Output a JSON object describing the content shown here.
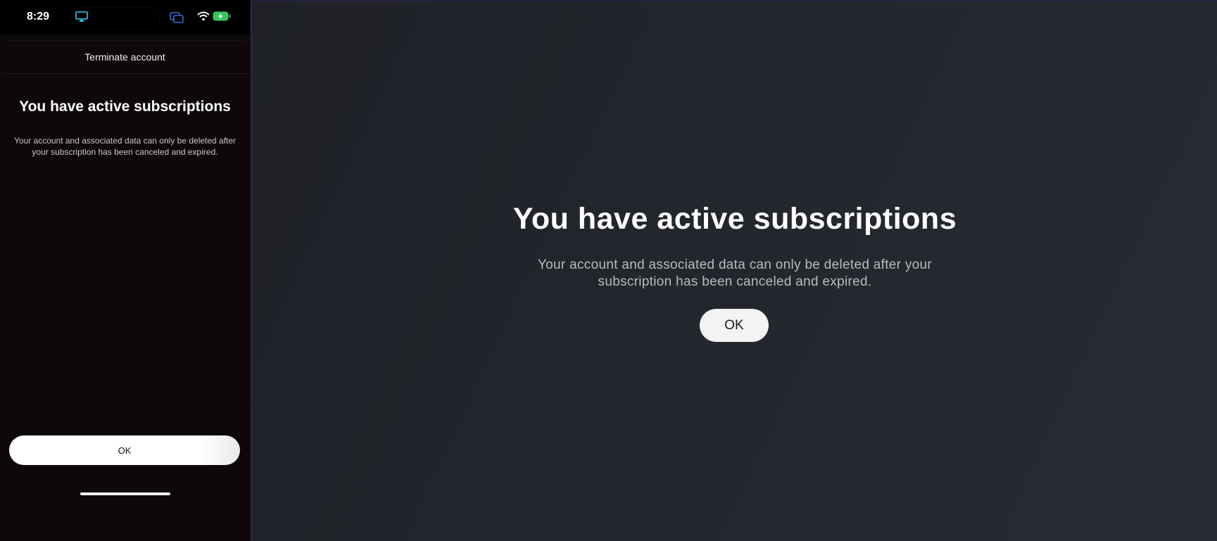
{
  "status_bar": {
    "time": "8:29",
    "icons": [
      "airplay-icon",
      "screen-mirroring-icon",
      "wifi-icon",
      "battery-charging-icon"
    ]
  },
  "phone": {
    "sheet_title": "Terminate account",
    "heading": "You have active subscriptions",
    "body": "Your account and associated data can only be deleted after your subscription has been canceled and expired.",
    "ok_label": "OK"
  },
  "tv": {
    "heading": "You have active subscriptions",
    "body": "Your account and associated data can only be deleted after your subscription has been canceled and expired.",
    "ok_label": "OK"
  },
  "colors": {
    "airplay_accent": "#2bb3d9",
    "screen_icon_accent": "#3a6ad6",
    "battery_fill": "#34c759"
  }
}
